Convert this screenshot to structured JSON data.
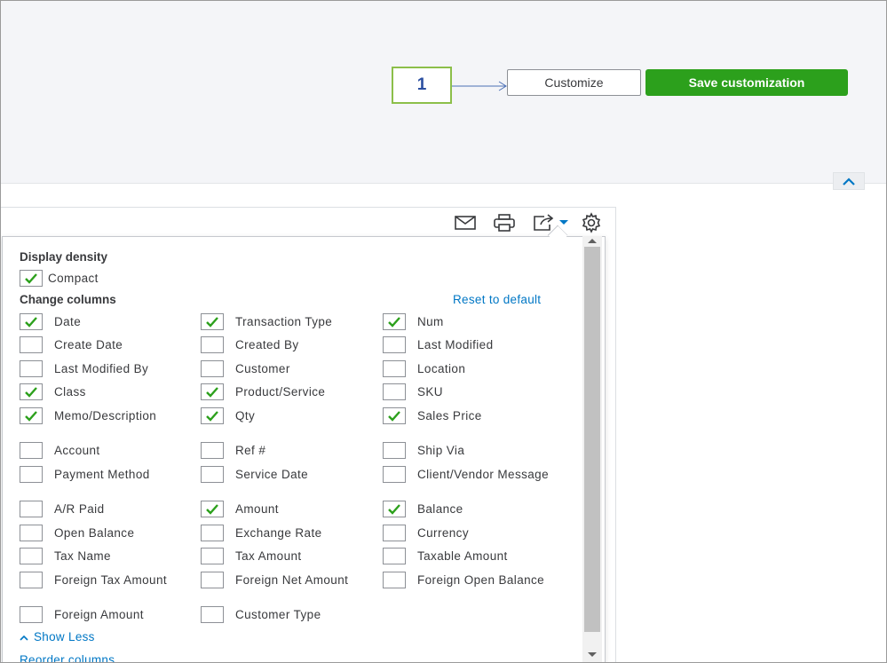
{
  "callout": {
    "label": "1"
  },
  "header": {
    "customize_label": "Customize",
    "save_label": "Save customization"
  },
  "toolbar": {
    "icons": [
      "mail-icon",
      "print-icon",
      "export-icon",
      "gear-icon"
    ]
  },
  "settings": {
    "density_title": "Display density",
    "compact_label": "Compact",
    "compact_checked": true,
    "columns_title": "Change columns",
    "reset_label": "Reset to default",
    "columns": [
      {
        "label": "Date",
        "checked": true
      },
      {
        "label": "Transaction Type",
        "checked": true
      },
      {
        "label": "Num",
        "checked": true
      },
      {
        "label": "Create Date",
        "checked": false
      },
      {
        "label": "Created By",
        "checked": false
      },
      {
        "label": "Last Modified",
        "checked": false
      },
      {
        "label": "Last Modified By",
        "checked": false
      },
      {
        "label": "Customer",
        "checked": false
      },
      {
        "label": "Location",
        "checked": false
      },
      {
        "label": "Class",
        "checked": true
      },
      {
        "label": "Product/Service",
        "checked": true
      },
      {
        "label": "SKU",
        "checked": false
      },
      {
        "label": "Memo/Description",
        "checked": true
      },
      {
        "label": "Qty",
        "checked": true
      },
      {
        "label": "Sales Price",
        "checked": true
      },
      {
        "label": "Account",
        "checked": false
      },
      {
        "label": "Ref #",
        "checked": false
      },
      {
        "label": "Ship Via",
        "checked": false
      },
      {
        "label": "Payment Method",
        "checked": false
      },
      {
        "label": "Service Date",
        "checked": false
      },
      {
        "label": "Client/Vendor Message",
        "checked": false
      },
      {
        "label": "A/R Paid",
        "checked": false
      },
      {
        "label": "Amount",
        "checked": true
      },
      {
        "label": "Balance",
        "checked": true
      },
      {
        "label": "Open Balance",
        "checked": false
      },
      {
        "label": "Exchange Rate",
        "checked": false
      },
      {
        "label": "Currency",
        "checked": false
      },
      {
        "label": "Tax Name",
        "checked": false
      },
      {
        "label": "Tax Amount",
        "checked": false
      },
      {
        "label": "Taxable Amount",
        "checked": false
      },
      {
        "label": "Foreign Tax Amount",
        "checked": false
      },
      {
        "label": "Foreign Net Amount",
        "checked": false
      },
      {
        "label": "Foreign Open Balance",
        "checked": false
      },
      {
        "label": "Foreign Amount",
        "checked": false
      },
      {
        "label": "Customer Type",
        "checked": false
      }
    ],
    "show_less_label": "Show Less",
    "reorder_label": "Reorder columns"
  },
  "colors": {
    "accent_green": "#2ca01c",
    "link_blue": "#0077c5",
    "callout_border": "#8cbf4a"
  }
}
